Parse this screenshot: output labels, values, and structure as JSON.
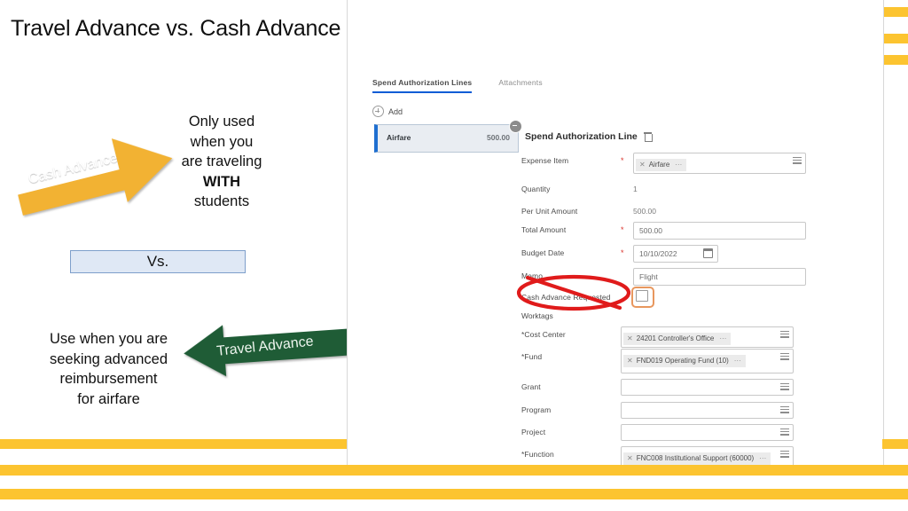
{
  "slide": {
    "title": "Travel Advance vs. Cash Advance",
    "cash_advance": {
      "arrow_label": "Cash Advance",
      "arrow_color": "#F2B233",
      "description_line1": "Only used",
      "description_line2": "when you",
      "description_line3": "are traveling",
      "description_emphasis": "WITH",
      "description_line4": "students"
    },
    "vs_label": "Vs.",
    "travel_advance": {
      "arrow_label": "Travel Advance",
      "arrow_color": "#1F5C36",
      "description_line1": "Use when you are",
      "description_line2": "seeking advanced",
      "description_line3": "reimbursement",
      "description_line4": "for airfare"
    },
    "accent_color": "#FCC430"
  },
  "workday": {
    "tabs": [
      {
        "label": "Spend Authorization Lines",
        "active": true
      },
      {
        "label": "Attachments",
        "active": false
      }
    ],
    "add_button": "Add",
    "line_card": {
      "name": "Airfare",
      "amount": "500.00"
    },
    "form_title": "Spend Authorization Line",
    "fields": [
      {
        "label": "Expense Item",
        "required": true,
        "type": "pill",
        "value": "Airfare"
      },
      {
        "label": "Quantity",
        "required": false,
        "type": "text",
        "value": "1"
      },
      {
        "label": "Per Unit Amount",
        "required": false,
        "type": "text",
        "value": "500.00"
      },
      {
        "label": "Total Amount",
        "required": true,
        "type": "input",
        "value": "500.00"
      },
      {
        "label": "Budget Date",
        "required": true,
        "type": "date",
        "value": "10/10/2022"
      },
      {
        "label": "Memo",
        "required": false,
        "type": "input",
        "value": "Flight"
      },
      {
        "label": "Cash Advance Requested",
        "required": false,
        "type": "checkbox",
        "value": ""
      }
    ],
    "worktags_label": "Worktags",
    "worktags": [
      {
        "label": "*Cost Center",
        "value": "24201 Controller's Office",
        "filled": true
      },
      {
        "label": "*Fund",
        "value": "FND019 Operating Fund (10)",
        "filled": true
      },
      {
        "label": "Grant",
        "value": "",
        "filled": false
      },
      {
        "label": "Program",
        "value": "",
        "filled": false
      },
      {
        "label": "Project",
        "value": "",
        "filled": false
      },
      {
        "label": "*Function",
        "value": "FNC008 Institutional Support (60000)",
        "filled": true
      }
    ],
    "annotation": {
      "type": "prohibition-circle-slash",
      "color": "#E01B1B",
      "targets": "Cash Advance Requested"
    },
    "checkbox_highlight_color": "#E8975E"
  }
}
